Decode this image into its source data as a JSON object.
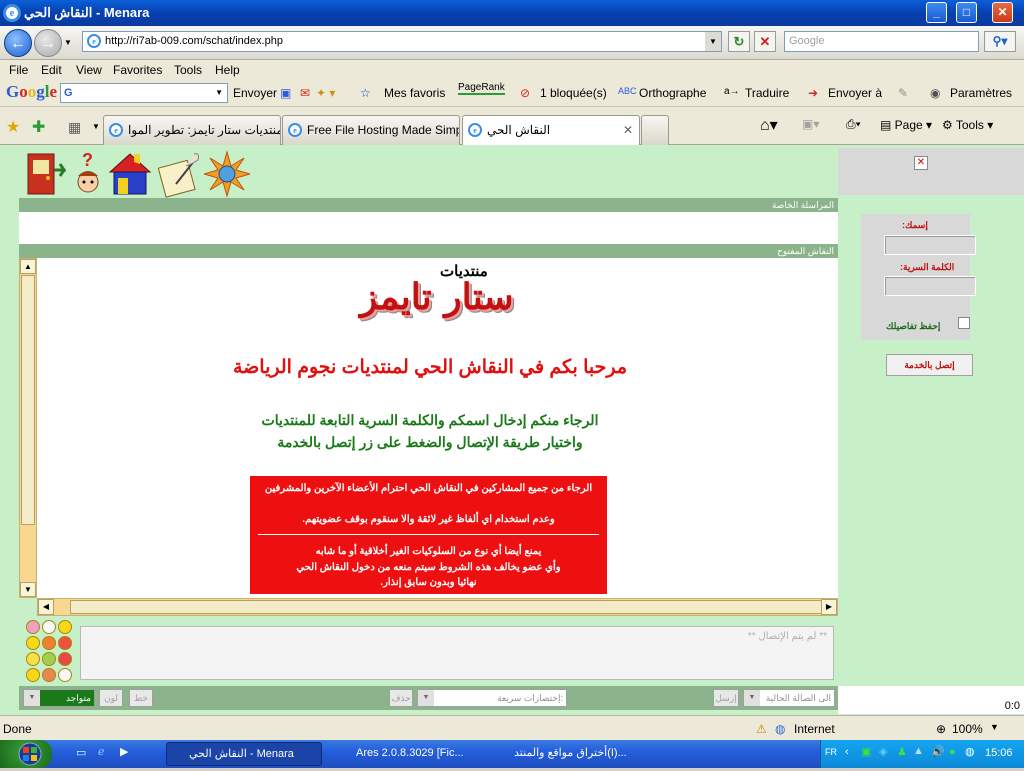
{
  "window": {
    "title": "النقاش الحي - Menara"
  },
  "address": {
    "url": "http://ri7ab-009.com/schat/index.php",
    "search_placeholder": "Google"
  },
  "menu": {
    "items": [
      "File",
      "Edit",
      "View",
      "Favorites",
      "Tools",
      "Help"
    ]
  },
  "google_toolbar": {
    "logo": "Google",
    "search_value": "G",
    "envoyer": "Envoyer",
    "favoris": "Mes favoris",
    "pagerank": "PageRank",
    "bloquees": "1 bloquée(s)",
    "orthographe": "Orthographe",
    "traduire": "Traduire",
    "envoyer_a": "Envoyer à",
    "parametres": "Paramètres"
  },
  "tabs": [
    {
      "label": "منتديات ستار تايمز: تطوير الموا..."
    },
    {
      "label": "Free File Hosting Made Simpl..."
    },
    {
      "label": "النقاش الحي"
    }
  ],
  "tabbar_right": {
    "page": "Page",
    "tools": "Tools"
  },
  "chat": {
    "private_header": "المراسلة الخاصة",
    "open_header": "النقاش المفتوح",
    "logo_small": "منتديات",
    "logo_big": "ستار تايمز",
    "welcome": "مرحبا بكم في النقاش الحي لمنتديات نجوم الرياضة",
    "instruction1": "الرجاء منكم إدخال اسمكم والكلمة السرية التابعة للمنتديات",
    "instruction2": "واختيار طريقة الإتصال والضغط على زر إتصل بالخدمة",
    "rules_line1": "الرجاء من جميع المشاركين في النقاش الحي احترام الأعضاء الآخرين والمشرفين",
    "rules_line2": "وعدم استخدام اي ألفاظ غير لائقة والا سنقوم بوقف عضويتهم.",
    "rules_line3": "يمنع أيضا أي نوع من السلوكيات الغير أخلاقية أو ما شابه",
    "rules_line4": "وأي عضو يخالف هذه الشروط سيتم منعه من دخول النقاش الحي",
    "rules_line5": "نهائيا وبدون سابق إنذار.",
    "message_placeholder": "** لم يتم الإتصال **"
  },
  "bottom": {
    "status_select": "متواجد",
    "bold_btn": "لون",
    "font_btn": "خط",
    "shortcuts_select": "إختصارات سريعة:",
    "erase_btn": "حذف",
    "send_btn": "إرسل",
    "room_select": "الى الصالة الحالية"
  },
  "login": {
    "name_label": "إسمك:",
    "password_label": "الكلمة السرية:",
    "remember_label": "إحفظ تفاصيلك",
    "connect_button": "إتصل بالخدمة"
  },
  "side_status": "0:0",
  "statusbar": {
    "left": "Done",
    "zone": "Internet",
    "zoom": "100%"
  },
  "taskbar": {
    "tasks": [
      {
        "label": "النقاش الحي - Menara"
      },
      {
        "label": "Ares 2.0.8.3029 [Fic..."
      },
      {
        "label": "أختراق مواقع والمنتد(I)..."
      }
    ],
    "lang": "FR",
    "clock": "15:06"
  }
}
